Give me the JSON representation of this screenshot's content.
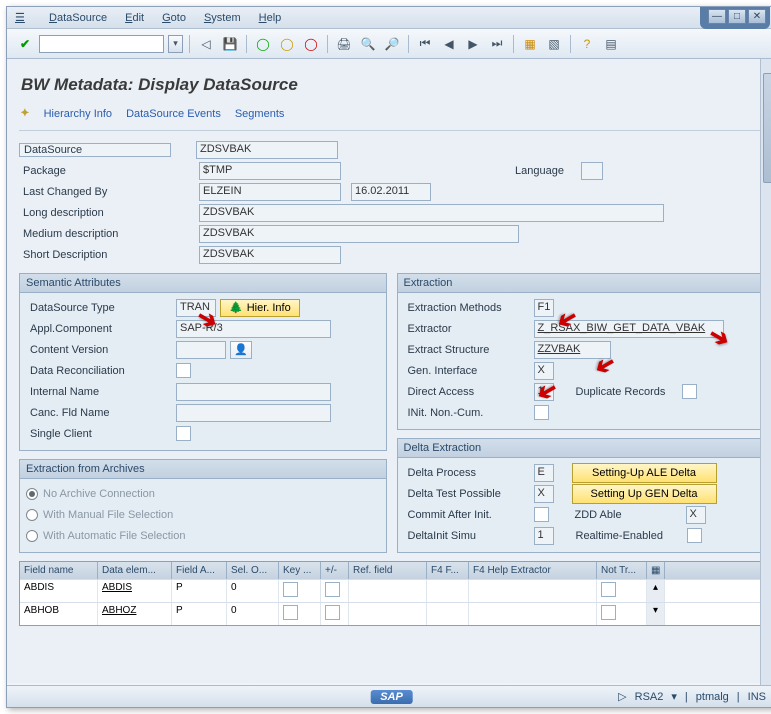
{
  "menu": {
    "items": [
      "DataSource",
      "Edit",
      "Goto",
      "System",
      "Help"
    ]
  },
  "page": {
    "title": "BW Metadata: Display DataSource"
  },
  "subnav": {
    "hierarchy": "Hierarchy Info",
    "events": "DataSource Events",
    "segments": "Segments"
  },
  "header": {
    "datasource_lbl": "DataSource",
    "datasource": "ZDSVBAK",
    "package_lbl": "Package",
    "package": "$TMP",
    "language_lbl": "Language",
    "language": "",
    "changedby_lbl": "Last Changed By",
    "changedby": "ELZEIN",
    "changed_date": "16.02.2011",
    "longdesc_lbl": "Long description",
    "longdesc": "ZDSVBAK",
    "meddesc_lbl": "Medium description",
    "meddesc": "ZDSVBAK",
    "shortdesc_lbl": "Short Description",
    "shortdesc": "ZDSVBAK"
  },
  "semantic": {
    "title": "Semantic Attributes",
    "dstype_lbl": "DataSource Type",
    "dstype": "TRAN",
    "hier_btn": "Hier. Info",
    "applcomp_lbl": "Appl.Component",
    "applcomp": "SAP-R/3",
    "contver_lbl": "Content Version",
    "contver": "",
    "datarecon_lbl": "Data Reconciliation",
    "intname_lbl": "Internal Name",
    "intname": "",
    "cancfld_lbl": "Canc. Fld Name",
    "cancfld": "",
    "singleclient_lbl": "Single Client"
  },
  "extraction": {
    "title": "Extraction",
    "methods_lbl": "Extraction Methods",
    "methods": "F1",
    "extractor_lbl": "Extractor",
    "extractor": "Z_RSAX_BIW_GET_DATA_VBAK",
    "structure_lbl": "Extract Structure",
    "structure": "ZZVBAK",
    "genint_lbl": "Gen. Interface",
    "genint": "X",
    "direct_lbl": "Direct Access",
    "direct": "1",
    "dup_lbl": "Duplicate Records",
    "initnon_lbl": "INit. Non.-Cum."
  },
  "archives": {
    "title": "Extraction from Archives",
    "opt1": "No Archive Connection",
    "opt2": "With Manual File Selection",
    "opt3": "With Automatic File Selection"
  },
  "delta": {
    "title": "Delta Extraction",
    "process_lbl": "Delta Process",
    "process": "E",
    "ale_btn": "Setting-Up ALE Delta",
    "test_lbl": "Delta Test Possible",
    "test": "X",
    "gen_btn": "Setting Up GEN Delta",
    "commit_lbl": "Commit After Init.",
    "zdd_lbl": "ZDD Able",
    "zdd": "X",
    "simu_lbl": "DeltaInit Simu",
    "simu": "1",
    "realtime_lbl": "Realtime-Enabled"
  },
  "table": {
    "cols": [
      "Field name",
      "Data elem...",
      "Field A...",
      "Sel. O...",
      "Key ...",
      "+/-",
      "Ref. field",
      "F4 F...",
      "F4 Help Extractor",
      "Not Tr..."
    ],
    "rows": [
      {
        "field": "ABDIS",
        "elem": "ABDIS",
        "fa": "P",
        "sel": "0"
      },
      {
        "field": "ABHOB",
        "elem": "ABHOZ",
        "fa": "P",
        "sel": "0"
      }
    ]
  },
  "status": {
    "tcode": "RSA2",
    "user": "ptmalg",
    "mode": "INS"
  }
}
